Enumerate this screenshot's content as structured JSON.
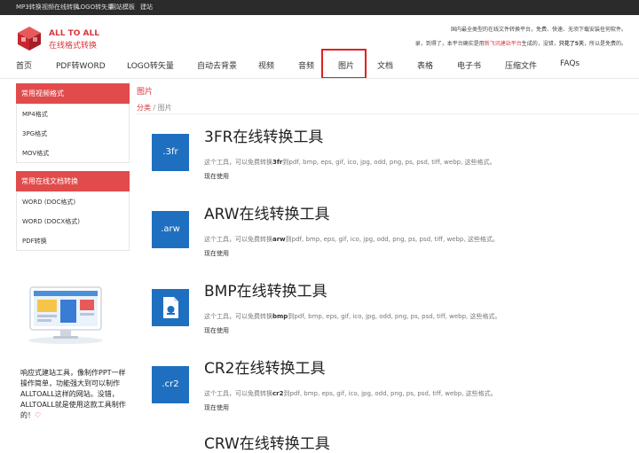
{
  "topbar": {
    "links": [
      "MP3转换",
      "视频在线转换",
      "LOGO转矢量",
      "网站模板",
      "建站"
    ]
  },
  "brand": {
    "name": "ALL TO ALL",
    "subtitle": "在线格式转换"
  },
  "header_desc": {
    "line1": "国内最全类型的在线文件转换平台，免费、快速、无须下载安装任何软件。",
    "line2_a": "录，到得了，本平台确实是用",
    "line2_red": "新飞讯建站平台",
    "line2_b": "生成的，没错，",
    "line2_bold": "只花了5天",
    "line2_c": "，所以是免费的。"
  },
  "nav": {
    "items": [
      "首页",
      "PDF转WORD",
      "LOGO转矢量",
      "自动去背景",
      "视频",
      "音频",
      "图片",
      "文档",
      "表格",
      "电子书",
      "压缩文件",
      "FAQs"
    ],
    "active": "图片"
  },
  "sidebar": {
    "video_title": "常用视频格式",
    "video_items": [
      "MP4格式",
      "3PG格式",
      "MOV格式"
    ],
    "doc_title": "常用在线文档转换",
    "doc_items": [
      "WORD (DOC格式)",
      "WORD (DOCX格式)",
      "PDF转换"
    ],
    "promo_text": "响应式建站工具，像制作PPT一样操作简单，功能强大到可以制作ALLTOALL这样的网站。没错，ALLTOALL就是使用这款工具制作的！",
    "promo_heart": "♡"
  },
  "main": {
    "category_title": "图片",
    "breadcrumb_link": "分类",
    "breadcrumb_sep": " / ",
    "breadcrumb_current": "图片",
    "desc_prefix": "这个工具，可以免费转换",
    "desc_suffix": "到pdf, bmp, eps, gif, ico, jpg, odd, png, ps, psd, tiff, webp, 这些格式。",
    "use_label": "现在使用",
    "tools": [
      {
        "icon": ".3fr",
        "title": "3FR在线转换工具",
        "fmt": "3fr"
      },
      {
        "icon": ".arw",
        "title": "ARW在线转换工具",
        "fmt": "arw"
      },
      {
        "icon": "",
        "title": "BMP在线转换工具",
        "fmt": "bmp"
      },
      {
        "icon": ".cr2",
        "title": "CR2在线转换工具",
        "fmt": "cr2"
      }
    ],
    "partial_title": "CRW在线转换工具"
  },
  "colors": {
    "accent": "#d9363e",
    "icon_blue": "#1f6fc0",
    "topbar": "#2b2b2b"
  }
}
